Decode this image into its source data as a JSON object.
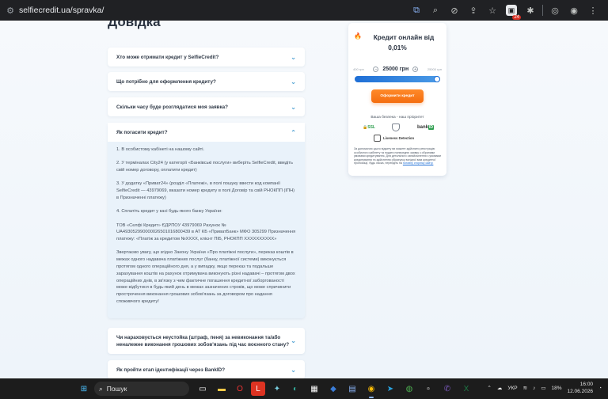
{
  "browser": {
    "url": "selfiecredit.ua/spravka/",
    "ext_badge": "24"
  },
  "page": {
    "title": "Довідка"
  },
  "faq": {
    "items": [
      {
        "question": "Хто може отримати кредит у SelfieCredit?"
      },
      {
        "question": "Що потрібно для оформлення кредиту?"
      },
      {
        "question": "Скільки часу буде розглядатися моя заявка?"
      },
      {
        "question": "Як погасити кредит?"
      },
      {
        "question": "Чи нараховується неустойка (штраф, пеня) за невиконання та/або неналежне виконання грошових зобов'язань під час воєнного стану?"
      },
      {
        "question": "Як пройти етап ідентифікації через BankID?"
      }
    ],
    "open_answer": [
      "1. В особистому кабінеті на нашому сайті.",
      "2. У терміналах City24 (у категорії «Банківські послуги» виберіть SelfieCredit, введіть свій номер договору, оплатити кредит)",
      "3. У додатку «Приват24» (розділ «Платежі», в полі пошуку ввести код компанії SelfieCredit — 43979069, вказати номер кредиту в полі Договір та свій РНОКПП (ІПН) в Призначенні платежу)",
      "4. Сплатіть кредит у касі будь-якого банку України:",
      "ТОВ «Селфі Кредит» ЄДРПОУ 43979069 Рахунок № UA493052990000026501016800439 в АТ КБ «ПриватБанк» МФО 305299 Призначення платежу: «Платіж за кредитом №ХХХХ, клієнт ПІБ, РНОКПП ХХХХХХХХХХ»",
      "Звертаємо увагу, що згідно Закону України «Про платіжні послуги», переказ коштів в межах одного надавача платіжних послуг (банку, платіжної системи) виконується протягом одного операційного дня, а у випадку, якщо переказ та подальше зарахування коштів на рахунок отримувача виконують різні надавачі – протягом двох операційних днів, в зв'язку з чим фактичне погашення кредитної заборгованості може відбутися в будь-який день в межах зазначених строків, що може спричинити прострочення виконання грошових зобов'язань за договором про надання споживчого кредиту!"
    ]
  },
  "calculator": {
    "title": "Кредит онлайн від",
    "rate": "0,01%",
    "min_label": "400 грн",
    "max_label": "25000 грн",
    "amount": "25000 грн",
    "minus": "−",
    "plus": "+",
    "slider_fraction": 1.0,
    "cta_label": "Оформити кредит",
    "security_label": "Ваша безпека - наш пріоритет",
    "ssl_label": "SSL",
    "bankid_label": "bank",
    "bankid_suffix": "ID",
    "liveness_label": "Liveness Detection",
    "disclaimer_text": "За допомогою цього віджету ви можете здійснити реєстрацію особистого кабінету та подати попередню заявку з обраними умовами кредитування. Для детального ознайомлення з умовами кредитування та здійснення обрахунку вигідної вам кредитної пропозиції, будь ласка, перейдіть на ",
    "disclaimer_link": "головну сторінку сайту."
  },
  "taskbar": {
    "search_placeholder": "Пошук",
    "lang": "УКР",
    "battery": "18%",
    "time": "16:00",
    "date": "12.06.2026"
  },
  "colors": {
    "accent_orange": "#f46d0f",
    "accent_blue": "#1f6fd6",
    "chev_blue": "#5aa7d6"
  }
}
